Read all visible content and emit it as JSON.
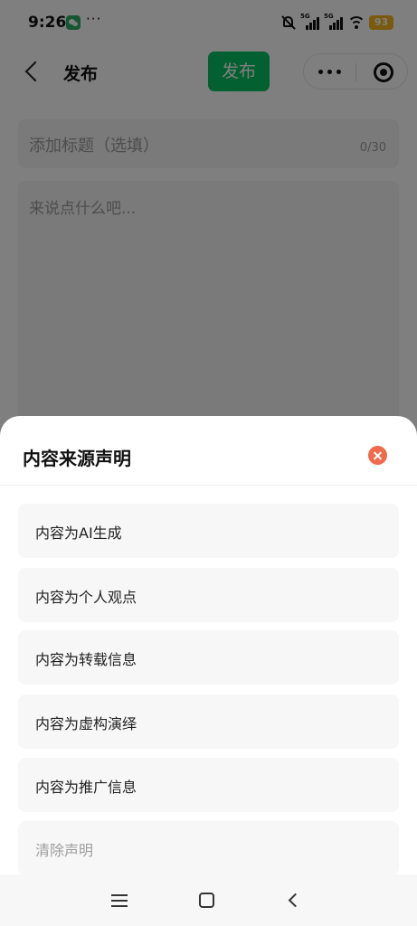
{
  "status_bar": {
    "time": "9:26",
    "dots": "···",
    "network_1": "5G",
    "network_2": "5G",
    "battery": "93",
    "icons": [
      "wechat-icon",
      "mute-icon",
      "signal-icon",
      "wifi-icon",
      "battery-icon"
    ]
  },
  "nav": {
    "title": "发布",
    "publish_label": "发布",
    "icons": [
      "back-icon",
      "more-icon",
      "close-miniprogram-icon"
    ]
  },
  "editor": {
    "title_placeholder": "添加标题（选填）",
    "title_counter": "0/30",
    "content_placeholder": "来说点什么吧..."
  },
  "sheet": {
    "title": "内容来源声明",
    "options": [
      {
        "label": "内容为AI生成"
      },
      {
        "label": "内容为个人观点"
      },
      {
        "label": "内容为转载信息"
      },
      {
        "label": "内容为虚构演绎"
      },
      {
        "label": "内容为推广信息"
      }
    ],
    "clear_label": "清除声明"
  },
  "system_nav": {
    "icons": [
      "menu-icon",
      "home-icon",
      "back-icon"
    ]
  },
  "colors": {
    "accent_green": "#07c160",
    "close_red": "#f06a4e",
    "battery_yellow": "#f4b51d"
  }
}
